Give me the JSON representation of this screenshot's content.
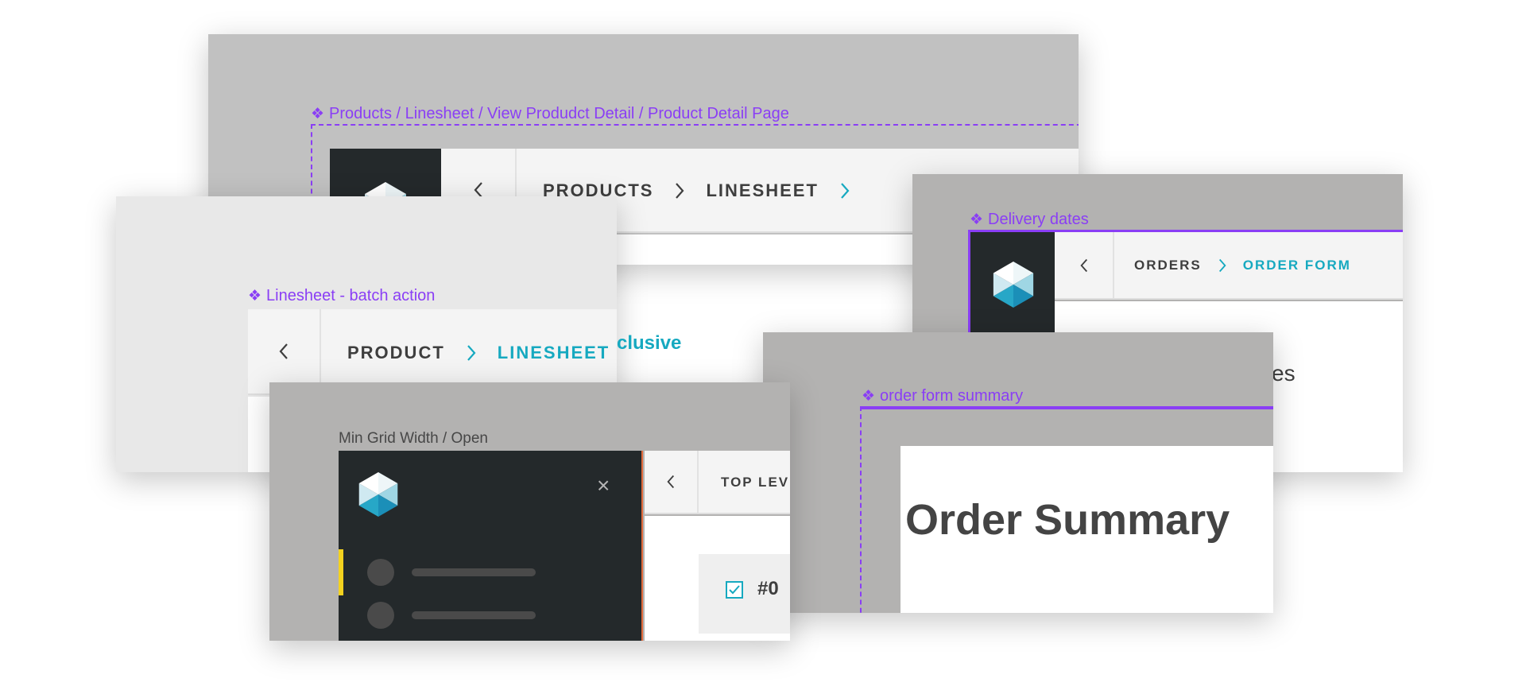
{
  "panels": {
    "product_detail": {
      "caption_glyph": "❖",
      "caption": "Products / Linesheet / View Produdct Detail / Product Detail Page",
      "breadcrumb": [
        "PRODUCTS",
        "LINESHEET"
      ],
      "partial_text": "clusive"
    },
    "delivery_dates": {
      "caption_glyph": "❖",
      "caption": "Delivery dates",
      "breadcrumb": [
        "ORDERS",
        "ORDER FORM"
      ],
      "partial_text": "es"
    },
    "batch_action": {
      "caption_glyph": "❖",
      "caption": "Linesheet - batch action",
      "breadcrumb": [
        "PRODUCT",
        "LINESHEET"
      ]
    },
    "order_summary": {
      "caption_glyph": "❖",
      "caption": "order form summary",
      "heading": "Order Summary"
    },
    "min_grid": {
      "caption": "Min Grid Width / Open",
      "breadcrumb": [
        "TOP LEV"
      ],
      "close_glyph": "×",
      "row_text": "#0"
    }
  },
  "icons": {
    "back": "chevron-left-icon",
    "separator": "chevron-right-icon",
    "logo": "hexagon-logo-icon",
    "close": "close-icon",
    "checkbox": "checkbox-checked-icon"
  },
  "colors": {
    "accent_purple": "#8a3ef5",
    "accent_teal": "#16a9c0",
    "sidebar_dark": "#24292b",
    "active_yellow": "#f4d21f"
  }
}
